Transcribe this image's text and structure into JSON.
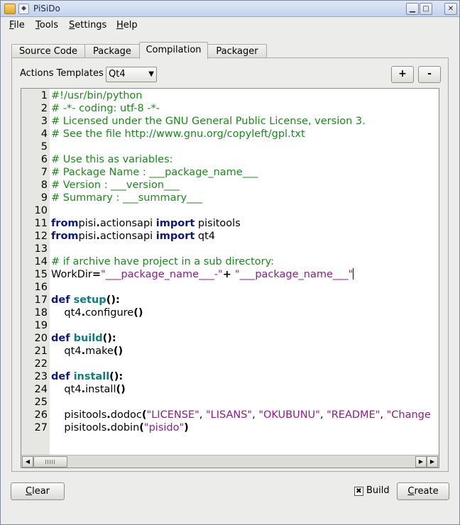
{
  "window": {
    "title": "PiSiDo"
  },
  "menu": {
    "items": [
      "File",
      "Tools",
      "Settings",
      "Help"
    ]
  },
  "tabs": [
    "Source Code",
    "Package",
    "Compilation",
    "Packager"
  ],
  "templates": {
    "label": "Actions Templates",
    "selected": "Qt4",
    "add": "+",
    "remove": "-"
  },
  "editor": {
    "lines": [
      [
        [
          "cm",
          "#!/usr/bin/python"
        ]
      ],
      [
        [
          "cm",
          "# -*- coding: utf-8 -*-"
        ]
      ],
      [
        [
          "cm",
          "# Licensed under the GNU General Public License, version 3."
        ]
      ],
      [
        [
          "cm",
          "# See the file http://www.gnu.org/copyleft/gpl.txt"
        ]
      ],
      [],
      [
        [
          "cm",
          "# Use this as variables:"
        ]
      ],
      [
        [
          "cm",
          "# Package Name : ___package_name___"
        ]
      ],
      [
        [
          "cm",
          "# Version : ___version___"
        ]
      ],
      [
        [
          "cm",
          "# Summary : ___summary___"
        ]
      ],
      [],
      [
        [
          "kw",
          "from"
        ],
        [
          "",
          "pisi"
        ],
        [
          "op",
          "."
        ],
        [
          "",
          "actionsapi "
        ],
        [
          "kw",
          "import"
        ],
        [
          "",
          " pisitools"
        ]
      ],
      [
        [
          "kw",
          "from"
        ],
        [
          "",
          "pisi"
        ],
        [
          "op",
          "."
        ],
        [
          "",
          "actionsapi "
        ],
        [
          "kw",
          "import"
        ],
        [
          "",
          " qt4"
        ]
      ],
      [],
      [
        [
          "cm",
          "# if archive have project in a sub directory:"
        ]
      ],
      [
        [
          "",
          "WorkDir"
        ],
        [
          "op",
          "="
        ],
        [
          "st",
          "\"___package_name___-\""
        ],
        [
          "op",
          "+ "
        ],
        [
          "st",
          "\"___package_name___\""
        ],
        [
          "cursor",
          ""
        ]
      ],
      [],
      [
        [
          "kw",
          "def "
        ],
        [
          "fn",
          "setup"
        ],
        [
          "op",
          "():"
        ]
      ],
      [
        [
          "",
          "    qt4"
        ],
        [
          "op",
          "."
        ],
        [
          "",
          "configure"
        ],
        [
          "op",
          "()"
        ]
      ],
      [],
      [
        [
          "kw",
          "def "
        ],
        [
          "fn",
          "build"
        ],
        [
          "op",
          "():"
        ]
      ],
      [
        [
          "",
          "    qt4"
        ],
        [
          "op",
          "."
        ],
        [
          "",
          "make"
        ],
        [
          "op",
          "()"
        ]
      ],
      [],
      [
        [
          "kw",
          "def "
        ],
        [
          "fn",
          "install"
        ],
        [
          "op",
          "():"
        ]
      ],
      [
        [
          "",
          "    qt4"
        ],
        [
          "op",
          "."
        ],
        [
          "",
          "install"
        ],
        [
          "op",
          "()"
        ]
      ],
      [],
      [
        [
          "",
          "    pisitools"
        ],
        [
          "op",
          "."
        ],
        [
          "",
          "dodoc"
        ],
        [
          "op",
          "("
        ],
        [
          "st",
          "\"LICENSE\""
        ],
        [
          "",
          ", "
        ],
        [
          "st",
          "\"LISANS\""
        ],
        [
          "",
          ", "
        ],
        [
          "st",
          "\"OKUBUNU\""
        ],
        [
          "",
          ", "
        ],
        [
          "st",
          "\"README\""
        ],
        [
          "",
          ", "
        ],
        [
          "st",
          "\"Change"
        ]
      ],
      [
        [
          "",
          "    pisitools"
        ],
        [
          "op",
          "."
        ],
        [
          "",
          "dobin"
        ],
        [
          "op",
          "("
        ],
        [
          "st",
          "\"pisido\""
        ],
        [
          "op",
          ")"
        ]
      ]
    ]
  },
  "footer": {
    "clear": "Clear",
    "build": "Build",
    "create": "Create"
  },
  "icons": {
    "checkmark": "✖",
    "combo_arrow": "▼",
    "scroll_left": "◀",
    "scroll_right": "▶",
    "scroll_right2": "▶"
  }
}
